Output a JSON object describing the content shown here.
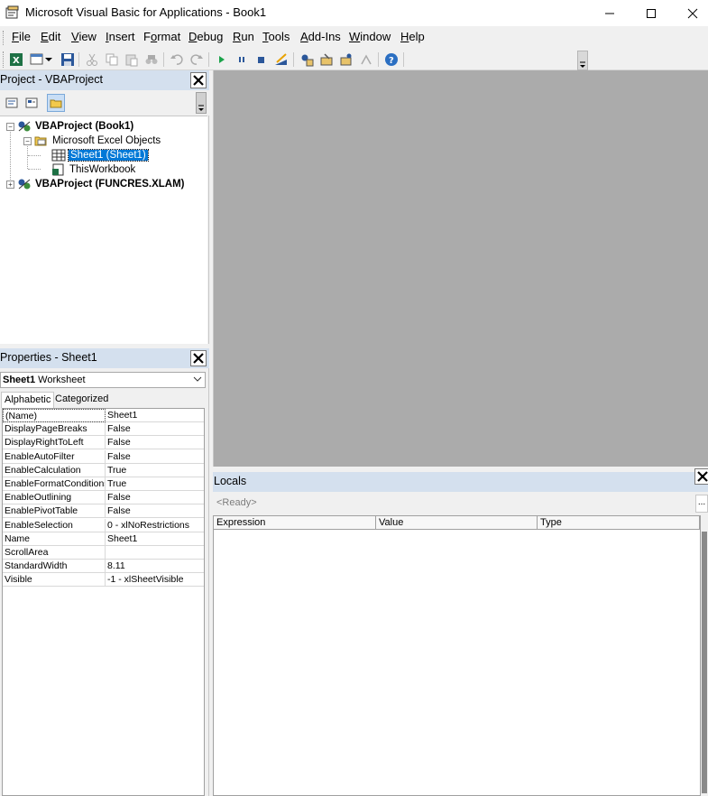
{
  "window": {
    "title": "Microsoft Visual Basic for Applications - Book1"
  },
  "menu": {
    "items": [
      {
        "pre": "",
        "key": "F",
        "post": "ile"
      },
      {
        "pre": "",
        "key": "E",
        "post": "dit"
      },
      {
        "pre": "",
        "key": "V",
        "post": "iew"
      },
      {
        "pre": "",
        "key": "I",
        "post": "nsert"
      },
      {
        "pre": "F",
        "key": "o",
        "post": "rmat"
      },
      {
        "pre": "",
        "key": "D",
        "post": "ebug"
      },
      {
        "pre": "",
        "key": "R",
        "post": "un"
      },
      {
        "pre": "",
        "key": "T",
        "post": "ools"
      },
      {
        "pre": "",
        "key": "A",
        "post": "dd-Ins"
      },
      {
        "pre": "",
        "key": "W",
        "post": "indow"
      },
      {
        "pre": "",
        "key": "H",
        "post": "elp"
      }
    ]
  },
  "project": {
    "title": "Project - VBAProject",
    "tree": {
      "root1": "VBAProject (Book1)",
      "folder": "Microsoft Excel Objects",
      "sheet": "Sheet1 (Sheet1)",
      "workbook": "ThisWorkbook",
      "root2": "VBAProject (FUNCRES.XLAM)"
    }
  },
  "properties": {
    "title": "Properties - Sheet1",
    "object_name": "Sheet1",
    "object_type": "Worksheet",
    "tabs": [
      "Alphabetic",
      "Categorized"
    ],
    "rows": [
      {
        "name": "(Name)",
        "value": "Sheet1"
      },
      {
        "name": "DisplayPageBreaks",
        "value": "False"
      },
      {
        "name": "DisplayRightToLeft",
        "value": "False"
      },
      {
        "name": "EnableAutoFilter",
        "value": "False"
      },
      {
        "name": "EnableCalculation",
        "value": "True"
      },
      {
        "name": "EnableFormatConditions",
        "value": "True"
      },
      {
        "name": "EnableOutlining",
        "value": "False"
      },
      {
        "name": "EnablePivotTable",
        "value": "False"
      },
      {
        "name": "EnableSelection",
        "value": "0 - xlNoRestrictions"
      },
      {
        "name": "Name",
        "value": "Sheet1"
      },
      {
        "name": "ScrollArea",
        "value": ""
      },
      {
        "name": "StandardWidth",
        "value": "8.11"
      },
      {
        "name": "Visible",
        "value": "-1 - xlSheetVisible"
      }
    ]
  },
  "locals": {
    "title": "Locals",
    "status": "<Ready>",
    "ellipsis": "...",
    "columns": [
      "Expression",
      "Value",
      "Type"
    ]
  },
  "colors": {
    "pane_header": "#d4e0ee",
    "mdi_background": "#ababab",
    "selection": "#0078d7"
  }
}
